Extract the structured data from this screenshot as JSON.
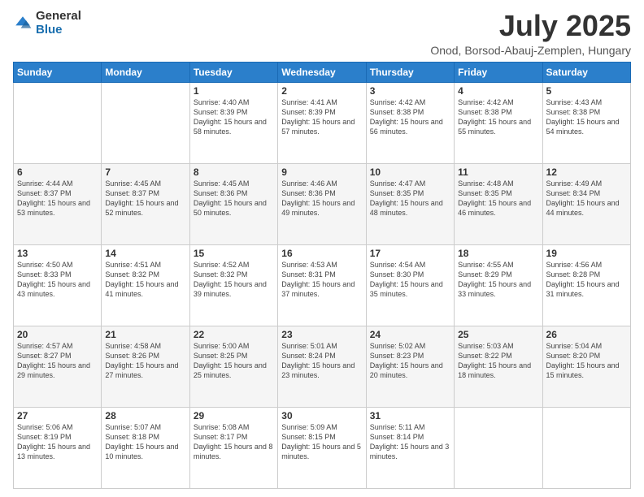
{
  "logo": {
    "general": "General",
    "blue": "Blue"
  },
  "header": {
    "month": "July 2025",
    "location": "Onod, Borsod-Abauj-Zemplen, Hungary"
  },
  "days_of_week": [
    "Sunday",
    "Monday",
    "Tuesday",
    "Wednesday",
    "Thursday",
    "Friday",
    "Saturday"
  ],
  "weeks": [
    [
      {
        "day": "",
        "sunrise": "",
        "sunset": "",
        "daylight": ""
      },
      {
        "day": "",
        "sunrise": "",
        "sunset": "",
        "daylight": ""
      },
      {
        "day": "1",
        "sunrise": "Sunrise: 4:40 AM",
        "sunset": "Sunset: 8:39 PM",
        "daylight": "Daylight: 15 hours and 58 minutes."
      },
      {
        "day": "2",
        "sunrise": "Sunrise: 4:41 AM",
        "sunset": "Sunset: 8:39 PM",
        "daylight": "Daylight: 15 hours and 57 minutes."
      },
      {
        "day": "3",
        "sunrise": "Sunrise: 4:42 AM",
        "sunset": "Sunset: 8:38 PM",
        "daylight": "Daylight: 15 hours and 56 minutes."
      },
      {
        "day": "4",
        "sunrise": "Sunrise: 4:42 AM",
        "sunset": "Sunset: 8:38 PM",
        "daylight": "Daylight: 15 hours and 55 minutes."
      },
      {
        "day": "5",
        "sunrise": "Sunrise: 4:43 AM",
        "sunset": "Sunset: 8:38 PM",
        "daylight": "Daylight: 15 hours and 54 minutes."
      }
    ],
    [
      {
        "day": "6",
        "sunrise": "Sunrise: 4:44 AM",
        "sunset": "Sunset: 8:37 PM",
        "daylight": "Daylight: 15 hours and 53 minutes."
      },
      {
        "day": "7",
        "sunrise": "Sunrise: 4:45 AM",
        "sunset": "Sunset: 8:37 PM",
        "daylight": "Daylight: 15 hours and 52 minutes."
      },
      {
        "day": "8",
        "sunrise": "Sunrise: 4:45 AM",
        "sunset": "Sunset: 8:36 PM",
        "daylight": "Daylight: 15 hours and 50 minutes."
      },
      {
        "day": "9",
        "sunrise": "Sunrise: 4:46 AM",
        "sunset": "Sunset: 8:36 PM",
        "daylight": "Daylight: 15 hours and 49 minutes."
      },
      {
        "day": "10",
        "sunrise": "Sunrise: 4:47 AM",
        "sunset": "Sunset: 8:35 PM",
        "daylight": "Daylight: 15 hours and 48 minutes."
      },
      {
        "day": "11",
        "sunrise": "Sunrise: 4:48 AM",
        "sunset": "Sunset: 8:35 PM",
        "daylight": "Daylight: 15 hours and 46 minutes."
      },
      {
        "day": "12",
        "sunrise": "Sunrise: 4:49 AM",
        "sunset": "Sunset: 8:34 PM",
        "daylight": "Daylight: 15 hours and 44 minutes."
      }
    ],
    [
      {
        "day": "13",
        "sunrise": "Sunrise: 4:50 AM",
        "sunset": "Sunset: 8:33 PM",
        "daylight": "Daylight: 15 hours and 43 minutes."
      },
      {
        "day": "14",
        "sunrise": "Sunrise: 4:51 AM",
        "sunset": "Sunset: 8:32 PM",
        "daylight": "Daylight: 15 hours and 41 minutes."
      },
      {
        "day": "15",
        "sunrise": "Sunrise: 4:52 AM",
        "sunset": "Sunset: 8:32 PM",
        "daylight": "Daylight: 15 hours and 39 minutes."
      },
      {
        "day": "16",
        "sunrise": "Sunrise: 4:53 AM",
        "sunset": "Sunset: 8:31 PM",
        "daylight": "Daylight: 15 hours and 37 minutes."
      },
      {
        "day": "17",
        "sunrise": "Sunrise: 4:54 AM",
        "sunset": "Sunset: 8:30 PM",
        "daylight": "Daylight: 15 hours and 35 minutes."
      },
      {
        "day": "18",
        "sunrise": "Sunrise: 4:55 AM",
        "sunset": "Sunset: 8:29 PM",
        "daylight": "Daylight: 15 hours and 33 minutes."
      },
      {
        "day": "19",
        "sunrise": "Sunrise: 4:56 AM",
        "sunset": "Sunset: 8:28 PM",
        "daylight": "Daylight: 15 hours and 31 minutes."
      }
    ],
    [
      {
        "day": "20",
        "sunrise": "Sunrise: 4:57 AM",
        "sunset": "Sunset: 8:27 PM",
        "daylight": "Daylight: 15 hours and 29 minutes."
      },
      {
        "day": "21",
        "sunrise": "Sunrise: 4:58 AM",
        "sunset": "Sunset: 8:26 PM",
        "daylight": "Daylight: 15 hours and 27 minutes."
      },
      {
        "day": "22",
        "sunrise": "Sunrise: 5:00 AM",
        "sunset": "Sunset: 8:25 PM",
        "daylight": "Daylight: 15 hours and 25 minutes."
      },
      {
        "day": "23",
        "sunrise": "Sunrise: 5:01 AM",
        "sunset": "Sunset: 8:24 PM",
        "daylight": "Daylight: 15 hours and 23 minutes."
      },
      {
        "day": "24",
        "sunrise": "Sunrise: 5:02 AM",
        "sunset": "Sunset: 8:23 PM",
        "daylight": "Daylight: 15 hours and 20 minutes."
      },
      {
        "day": "25",
        "sunrise": "Sunrise: 5:03 AM",
        "sunset": "Sunset: 8:22 PM",
        "daylight": "Daylight: 15 hours and 18 minutes."
      },
      {
        "day": "26",
        "sunrise": "Sunrise: 5:04 AM",
        "sunset": "Sunset: 8:20 PM",
        "daylight": "Daylight: 15 hours and 15 minutes."
      }
    ],
    [
      {
        "day": "27",
        "sunrise": "Sunrise: 5:06 AM",
        "sunset": "Sunset: 8:19 PM",
        "daylight": "Daylight: 15 hours and 13 minutes."
      },
      {
        "day": "28",
        "sunrise": "Sunrise: 5:07 AM",
        "sunset": "Sunset: 8:18 PM",
        "daylight": "Daylight: 15 hours and 10 minutes."
      },
      {
        "day": "29",
        "sunrise": "Sunrise: 5:08 AM",
        "sunset": "Sunset: 8:17 PM",
        "daylight": "Daylight: 15 hours and 8 minutes."
      },
      {
        "day": "30",
        "sunrise": "Sunrise: 5:09 AM",
        "sunset": "Sunset: 8:15 PM",
        "daylight": "Daylight: 15 hours and 5 minutes."
      },
      {
        "day": "31",
        "sunrise": "Sunrise: 5:11 AM",
        "sunset": "Sunset: 8:14 PM",
        "daylight": "Daylight: 15 hours and 3 minutes."
      },
      {
        "day": "",
        "sunrise": "",
        "sunset": "",
        "daylight": ""
      },
      {
        "day": "",
        "sunrise": "",
        "sunset": "",
        "daylight": ""
      }
    ]
  ]
}
